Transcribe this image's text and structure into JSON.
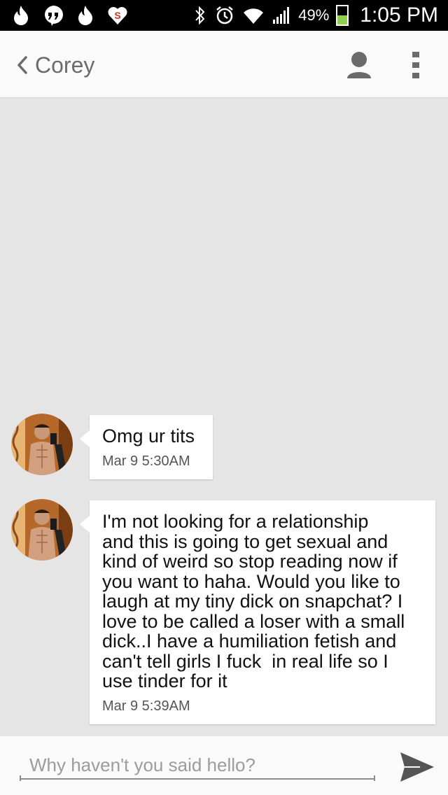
{
  "status_bar": {
    "battery_percent": "49%",
    "battery_level": 0.49,
    "time": "1:05 PM",
    "icons": [
      "tinder-flame-icon",
      "hangouts-quote-icon",
      "tinder-flame-icon",
      "dollar-heart-icon",
      "bluetooth-icon",
      "alarm-icon",
      "wifi-icon",
      "signal-icon",
      "battery-icon"
    ]
  },
  "header": {
    "contact_name": "Corey",
    "icons": [
      "back-chevron-icon",
      "profile-person-icon",
      "overflow-menu-icon"
    ]
  },
  "messages": [
    {
      "text": "Omg ur tits",
      "timestamp": "Mar 9  5:30AM"
    },
    {
      "text": "I'm not looking for a relationship\nand this is going to get sexual and\nkind of weird so stop reading now if\nyou want to haha. Would you like to\nlaugh at my tiny dick on snapchat? I\nlove to be called a loser with a small\ndick..I have a humiliation fetish and\ncan't tell girls I fuck  in real life so I\nuse tinder for it",
      "timestamp": "Mar 9  5:39AM"
    }
  ],
  "compose": {
    "placeholder": "Why haven't you said hello?",
    "value": "",
    "send_icon": "send-arrow-icon"
  },
  "colors": {
    "status_bar_bg": "#000000",
    "header_bg": "#fafafa",
    "thread_bg": "#e5e5e5",
    "bubble_bg": "#ffffff",
    "battery_fill": "#8fd14f"
  }
}
